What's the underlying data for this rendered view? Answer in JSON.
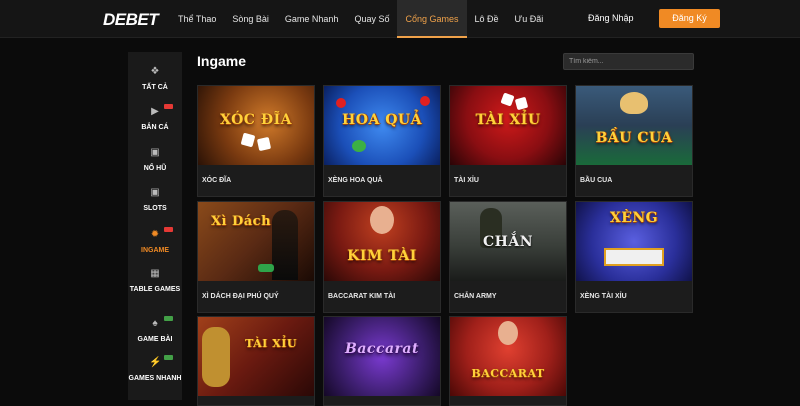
{
  "header": {
    "logo_de": "DE",
    "logo_bet": "BET",
    "nav": [
      "Thể Thao",
      "Sòng Bài",
      "Game Nhanh",
      "Quay Số",
      "Cổng Games",
      "Lô Đề",
      "Ưu Đãi"
    ],
    "active_nav": "Cổng Games",
    "login_label": "Đăng Nhập",
    "register_label": "Đăng Ký",
    "accent_color": "#f08a24"
  },
  "sidebar": {
    "items": [
      {
        "label": "TẤT CẢ",
        "icon": "grid-icon",
        "badge": null
      },
      {
        "label": "BẮN CÁ",
        "icon": "fish-icon",
        "badge": "hot"
      },
      {
        "label": "NỔ HŨ",
        "icon": "jackpot-icon",
        "badge": null
      },
      {
        "label": "SLOTS",
        "icon": "slot-machine-icon",
        "badge": null
      },
      {
        "label": "INGAME",
        "icon": "chip-icon",
        "badge": "hot",
        "active": true
      },
      {
        "label": "TABLE GAMES",
        "icon": "table-icon",
        "badge": null
      },
      {
        "label": "GAME BÀI",
        "icon": "cards-icon",
        "badge": "new"
      },
      {
        "label": "GAMES NHANH",
        "icon": "lightning-icon",
        "badge": "new"
      }
    ]
  },
  "main": {
    "title": "Ingame",
    "search_placeholder": "Tìm kiếm...",
    "games": [
      {
        "name": "XÓC ĐĨA",
        "thumb_text": "XÓC ĐĨA",
        "bg": "#7a3a10"
      },
      {
        "name": "XÈNG HOA QUẢ",
        "thumb_text": "HOA QUẢ",
        "bg": "#1b4fb8"
      },
      {
        "name": "TÀI XỈU",
        "thumb_text": "TÀI XỈU",
        "bg": "#8a0e12"
      },
      {
        "name": "BẦU CUA",
        "thumb_text": "BẦU CUA",
        "bg": "#2a3f55"
      },
      {
        "name": "XÌ DÁCH ĐẠI PHÚ QUÝ",
        "thumb_text": "Xì Dách",
        "bg": "#5a2a14"
      },
      {
        "name": "BACCARAT KIM TÀI",
        "thumb_text": "KIM TÀI",
        "bg": "#7a1a12"
      },
      {
        "name": "CHẮN ARMY",
        "thumb_text": "CHẮN",
        "bg": "#3a3f3a"
      },
      {
        "name": "XÈNG TÀI XỈU",
        "thumb_text": "XÈNG",
        "bg": "#2a2f9a"
      },
      {
        "name": "",
        "thumb_text": "TÀI XỈU",
        "bg": "#6a1a10"
      },
      {
        "name": "",
        "thumb_text": "Baccarat",
        "bg": "#3a1d6a"
      },
      {
        "name": "",
        "thumb_text": "BACCARAT",
        "bg": "#a0201a"
      }
    ]
  }
}
